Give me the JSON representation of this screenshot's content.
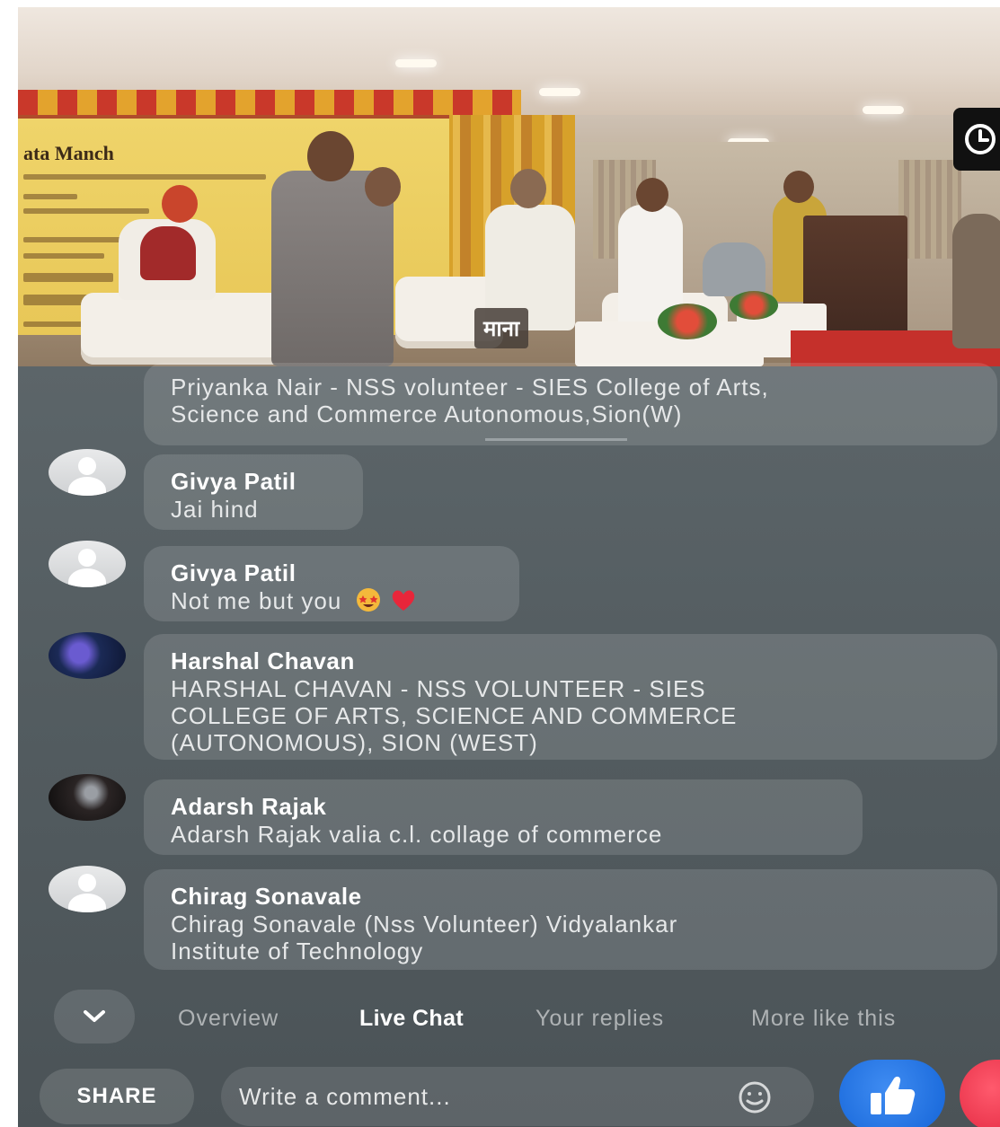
{
  "video": {
    "banner_title": "ata Manch",
    "caption_tag": "माना"
  },
  "comments": [
    {
      "name": "",
      "text_lines": [
        "Priyanka Nair - NSS volunteer - SIES College of Arts,",
        "Science and Commerce Autonomous,Sion(W)"
      ],
      "avatar": "none"
    },
    {
      "name": "Givya Patil",
      "text_lines": [
        "Jai hind"
      ],
      "avatar": "default-avatar-icon"
    },
    {
      "name": "Givya Patil",
      "text_lines": [
        "Not me but you"
      ],
      "emojis": [
        "star-struck-emoji-icon",
        "red-heart-emoji-icon"
      ],
      "avatar": "default-avatar-icon"
    },
    {
      "name": "Harshal Chavan",
      "text_lines": [
        "HARSHAL CHAVAN - NSS VOLUNTEER - SIES",
        "COLLEGE OF ARTS, SCIENCE AND COMMERCE",
        "(AUTONOMOUS), SION (WEST)"
      ],
      "avatar": "photo"
    },
    {
      "name": "Adarsh Rajak",
      "text_lines": [
        "Adarsh Rajak  valia c.l. collage of commerce"
      ],
      "avatar": "photo"
    },
    {
      "name": "Chirag Sonavale",
      "text_lines": [
        "Chirag Sonavale (Nss  Volunteer)  Vidyalankar",
        "Institute of Technology"
      ],
      "avatar": "default-avatar-icon"
    }
  ],
  "tabs": [
    {
      "label": "Overview",
      "active": false
    },
    {
      "label": "Live Chat",
      "active": true
    },
    {
      "label": "Your replies",
      "active": false
    },
    {
      "label": "More like this",
      "active": false
    }
  ],
  "composer": {
    "share_label": "SHARE",
    "comment_placeholder": "Write a comment..."
  },
  "colors": {
    "panel": "#535c60",
    "like_blue": "#1565d8",
    "love_red": "#e0243d"
  }
}
